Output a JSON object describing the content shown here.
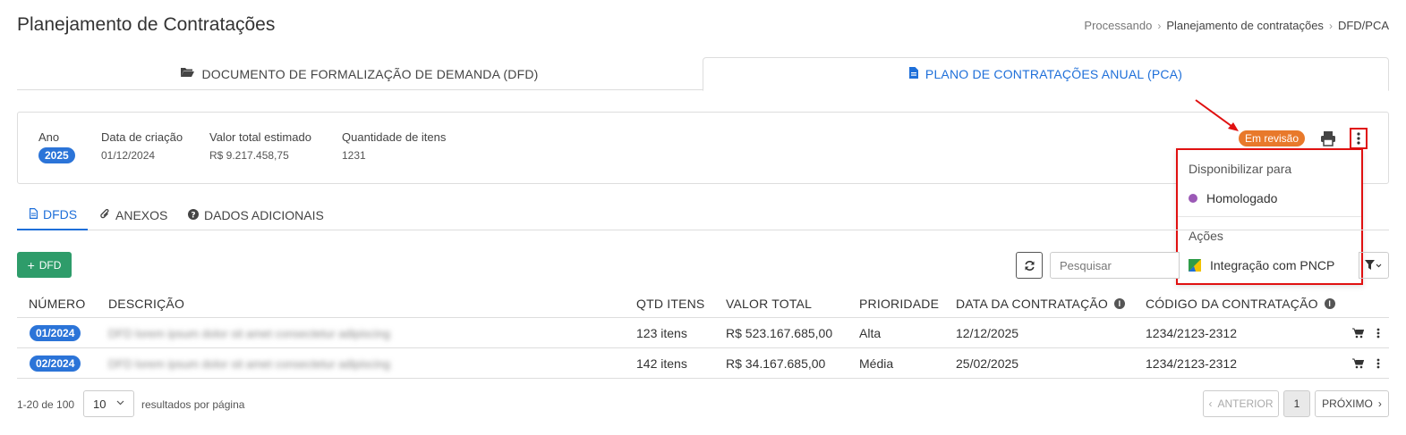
{
  "header": {
    "title": "Planejamento de Contratações",
    "breadcrumb": [
      "Processando",
      "Planejamento de contratações",
      "DFD/PCA"
    ]
  },
  "main_tabs": [
    {
      "label": "DOCUMENTO DE FORMALIZAÇÃO DE DEMANDA (DFD)",
      "icon": "folder-open-icon",
      "active": false
    },
    {
      "label": "PLANO DE CONTRATAÇÕES ANUAL (PCA)",
      "icon": "file-icon",
      "active": true
    }
  ],
  "info": {
    "ano_label": "Ano",
    "ano_value": "2025",
    "data_label": "Data de criação",
    "data_value": "01/12/2024",
    "valor_label": "Valor total estimado",
    "valor_value": "R$ 9.217.458,75",
    "qtd_label": "Quantidade de itens",
    "qtd_value": "1231",
    "status": "Em revisão"
  },
  "dropdown": {
    "header1": "Disponibilizar para",
    "item1": "Homologado",
    "header2": "Ações",
    "item2": "Integração com PNCP"
  },
  "sub_tabs": [
    {
      "label": "DFDS",
      "icon": "file-text-icon",
      "active": true
    },
    {
      "label": "ANEXOS",
      "icon": "paperclip-icon",
      "active": false
    },
    {
      "label": "DADOS ADICIONAIS",
      "icon": "question-circle-icon",
      "active": false
    }
  ],
  "toolbar": {
    "add_label": "DFD",
    "search_placeholder": "Pesquisar"
  },
  "table": {
    "columns": [
      "NÚMERO",
      "DESCRIÇÃO",
      "QTD ITENS",
      "VALOR TOTAL",
      "PRIORIDADE",
      "DATA DA CONTRATAÇÃO",
      "CÓDIGO DA CONTRATAÇÃO"
    ],
    "rows": [
      {
        "numero": "01/2024",
        "descricao": "DFD lorem ipsum dolor sit amet consectetur adipiscing",
        "qtd": "123 itens",
        "valor": "R$ 523.167.685,00",
        "prioridade": "Alta",
        "data": "12/12/2025",
        "codigo": "1234/2123-2312"
      },
      {
        "numero": "02/2024",
        "descricao": "DFD lorem ipsum dolor sit amet consectetur adipiscing",
        "qtd": "142 itens",
        "valor": "R$ 34.167.685,00",
        "prioridade": "Média",
        "data": "25/02/2025",
        "codigo": "1234/2123-2312"
      }
    ]
  },
  "footer": {
    "count": "1-20 de 100",
    "page_size": "10",
    "per_page_label": "resultados por página",
    "prev_label": "ANTERIOR",
    "page": "1",
    "next_label": "PRÓXIMO"
  }
}
